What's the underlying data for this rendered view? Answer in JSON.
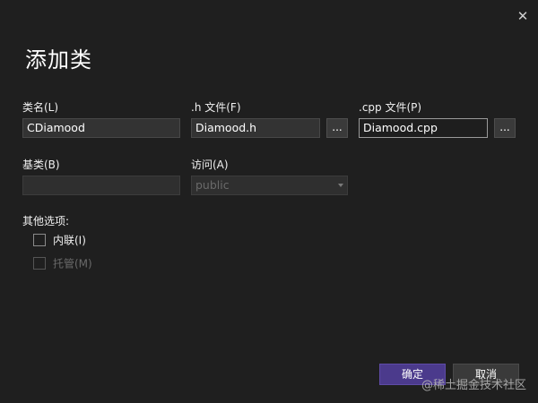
{
  "window": {
    "close_glyph": "✕"
  },
  "title": "添加类",
  "class_name": {
    "label": "类名(L)",
    "value": "CDiamood"
  },
  "h_file": {
    "label": ".h 文件(F)",
    "value": "Diamood.h",
    "browse_label": "..."
  },
  "cpp_file": {
    "label": ".cpp 文件(P)",
    "value": "Diamood.cpp",
    "browse_label": "..."
  },
  "base_class": {
    "label": "基类(B)",
    "value": ""
  },
  "access": {
    "label": "访问(A)",
    "value": "public"
  },
  "options": {
    "label": "其他选项:",
    "inline": {
      "label": "内联(I)",
      "checked": false
    },
    "managed": {
      "label": "托管(M)",
      "checked": false,
      "disabled": true
    }
  },
  "buttons": {
    "ok": "确定",
    "cancel": "取消"
  },
  "watermark": "@稀土掘金技术社区"
}
